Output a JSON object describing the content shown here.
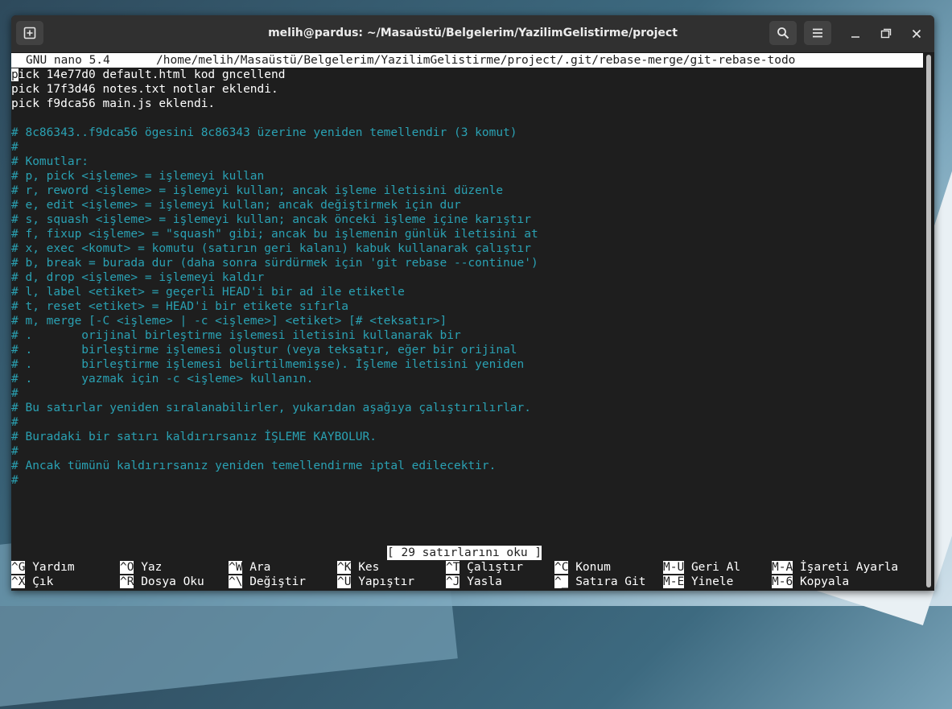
{
  "window": {
    "title": "melih@pardus: ~/Masaüstü/Belgelerim/YazilimGelistirme/project"
  },
  "nano": {
    "version": "GNU nano 5.4",
    "file_path": "/home/melih/Masaüstü/Belgelerim/YazilimGelistirme/project/.git/rebase-merge/git-rebase-todo",
    "lines": [
      "pick 14e77d0 default.html kod gncellend",
      "pick 17f3d46 notes.txt notlar eklendi.",
      "pick f9dca56 main.js eklendi.",
      "",
      "# 8c86343..f9dca56 ögesini 8c86343 üzerine yeniden temellendir (3 komut)",
      "#",
      "# Komutlar:",
      "# p, pick <işleme> = işlemeyi kullan",
      "# r, reword <işleme> = işlemeyi kullan; ancak işleme iletisini düzenle",
      "# e, edit <işleme> = işlemeyi kullan; ancak değiştirmek için dur",
      "# s, squash <işleme> = işlemeyi kullan; ancak önceki işleme içine karıştır",
      "# f, fixup <işleme> = \"squash\" gibi; ancak bu işlemenin günlük iletisini at",
      "# x, exec <komut> = komutu (satırın geri kalanı) kabuk kullanarak çalıştır",
      "# b, break = burada dur (daha sonra sürdürmek için 'git rebase --continue')",
      "# d, drop <işleme> = işlemeyi kaldır",
      "# l, label <etiket> = geçerli HEAD'i bir ad ile etiketle",
      "# t, reset <etiket> = HEAD'i bir etikete sıfırla",
      "# m, merge [-C <işleme> | -c <işleme>] <etiket> [# <teksatır>]",
      "# .       orijinal birleştirme işlemesi iletisini kullanarak bir",
      "# .       birleştirme işlemesi oluştur (veya teksatır, eğer bir orijinal",
      "# .       birleştirme işlemesi belirtilmemişse). İşleme iletisini yeniden",
      "# .       yazmak için -c <işleme> kullanın.",
      "#",
      "# Bu satırlar yeniden sıralanabilirler, yukarıdan aşağıya çalıştırılırlar.",
      "#",
      "# Buradaki bir satırı kaldırırsanız İŞLEME KAYBOLUR.",
      "#",
      "# Ancak tümünü kaldırırsanız yeniden temellendirme iptal edilecektir.",
      "#"
    ],
    "status": "[ 29 satırlarını oku ]",
    "shortcuts_row1": [
      {
        "key": "^G",
        "label": "Yardım"
      },
      {
        "key": "^O",
        "label": "Yaz"
      },
      {
        "key": "^W",
        "label": "Ara"
      },
      {
        "key": "^K",
        "label": "Kes"
      },
      {
        "key": "^T",
        "label": "Çalıştır"
      },
      {
        "key": "^C",
        "label": "Konum"
      },
      {
        "key": "M-U",
        "label": "Geri Al"
      },
      {
        "key": "M-A",
        "label": "İşareti Ayarla"
      }
    ],
    "shortcuts_row2": [
      {
        "key": "^X",
        "label": "Çık"
      },
      {
        "key": "^R",
        "label": "Dosya Oku"
      },
      {
        "key": "^\\",
        "label": "Değiştir"
      },
      {
        "key": "^U",
        "label": "Yapıştır"
      },
      {
        "key": "^J",
        "label": "Yasla"
      },
      {
        "key": "^_",
        "label": "Satıra Git"
      },
      {
        "key": "M-E",
        "label": "Yinele"
      },
      {
        "key": "M-6",
        "label": "Kopyala"
      }
    ]
  }
}
